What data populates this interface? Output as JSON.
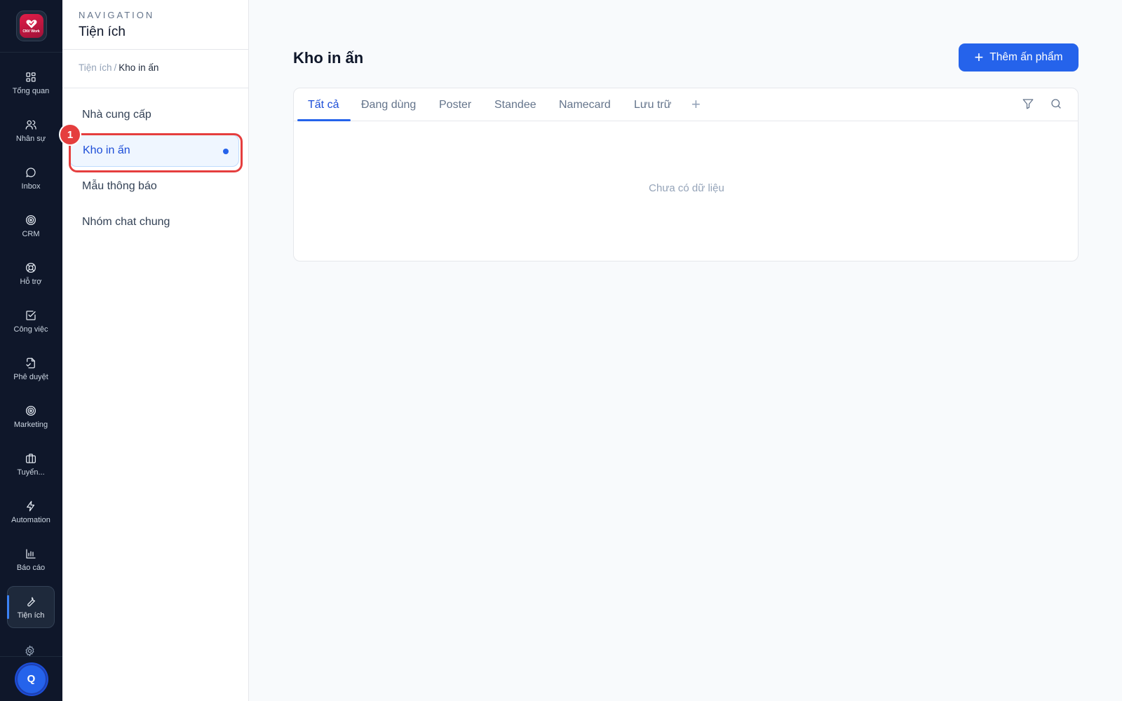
{
  "brand": {
    "logo_text": "CNV Work"
  },
  "rail": {
    "items": [
      {
        "label": "Tổng quan",
        "icon": "grid-icon"
      },
      {
        "label": "Nhân sự",
        "icon": "users-icon"
      },
      {
        "label": "Inbox",
        "icon": "chat-bubble-icon"
      },
      {
        "label": "CRM",
        "icon": "target-icon"
      },
      {
        "label": "Hỗ trợ",
        "icon": "lifebuoy-icon"
      },
      {
        "label": "Công việc",
        "icon": "check-square-icon"
      },
      {
        "label": "Phê duyệt",
        "icon": "file-approve-icon"
      },
      {
        "label": "Marketing",
        "icon": "target-icon"
      },
      {
        "label": "Tuyển...",
        "icon": "briefcase-icon"
      },
      {
        "label": "Automation",
        "icon": "lightning-icon"
      },
      {
        "label": "Báo cáo",
        "icon": "bar-chart-icon"
      },
      {
        "label": "Tiện ích",
        "icon": "wrench-icon"
      }
    ],
    "active_index": 11,
    "settings_icon": "gear-icon",
    "avatar_initial": "Q"
  },
  "subnav": {
    "eyebrow": "NAVIGATION",
    "title": "Tiện ích",
    "breadcrumb": {
      "parent": "Tiện ích",
      "separator": "/",
      "current": "Kho in ấn"
    },
    "items": [
      {
        "label": "Nhà cung cấp"
      },
      {
        "label": "Kho in ấn"
      },
      {
        "label": "Mẫu thông báo"
      },
      {
        "label": "Nhóm chat chung"
      }
    ],
    "active_index": 1
  },
  "annotation": {
    "step_number": "1"
  },
  "main": {
    "title": "Kho in ấn",
    "add_button_label": "Thêm ấn phẩm",
    "tabs": [
      {
        "label": "Tất cả"
      },
      {
        "label": "Đang dùng"
      },
      {
        "label": "Poster"
      },
      {
        "label": "Standee"
      },
      {
        "label": "Namecard"
      },
      {
        "label": "Lưu trữ"
      }
    ],
    "active_tab_index": 0,
    "add_tab_glyph": "+",
    "empty_text": "Chưa có dữ liệu"
  },
  "colors": {
    "rail_bg": "#0f172a",
    "accent": "#2563eb",
    "annotation_red": "#e53e3e"
  }
}
